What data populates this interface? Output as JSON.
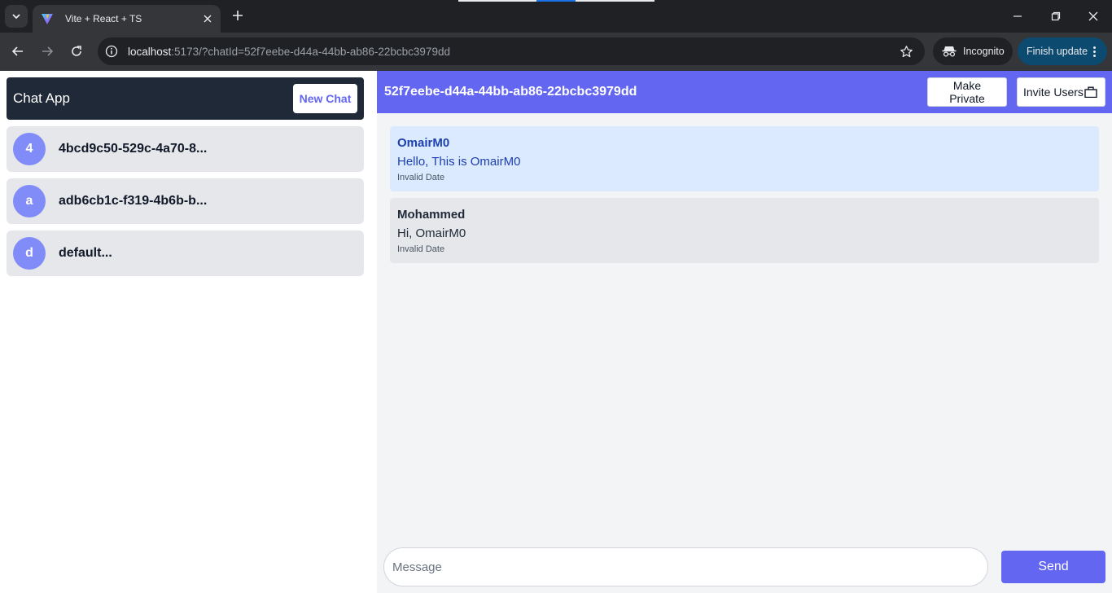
{
  "browser": {
    "tab_title": "Vite + React + TS",
    "url_host": "localhost",
    "url_rest": ":5173/?chatId=52f7eebe-d44a-44bb-ab86-22bcbc3979dd",
    "incognito_label": "Incognito",
    "update_label": "Finish update",
    "icons": [
      "tab-search-icon",
      "vite-favicon-icon",
      "close-icon",
      "plus-icon",
      "minimize-icon",
      "restore-icon",
      "close-window-icon",
      "back-arrow-icon",
      "forward-arrow-icon",
      "reload-icon",
      "site-info-icon",
      "star-icon",
      "incognito-icon",
      "kebab-menu-icon"
    ]
  },
  "sidebar": {
    "app_title": "Chat App",
    "new_chat_label": "New Chat",
    "chats": [
      {
        "initial": "4",
        "name": "4bcd9c50-529c-4a70-8..."
      },
      {
        "initial": "a",
        "name": "adb6cb1c-f319-4b6b-b..."
      },
      {
        "initial": "d",
        "name": "default..."
      }
    ]
  },
  "chat": {
    "title": "52f7eebe-d44a-44bb-ab86-22bcbc3979dd",
    "make_private_label": "Make Private",
    "invite_users_label": "Invite Users",
    "messages": [
      {
        "author": "OmairM0",
        "text": "Hello, This is OmairM0",
        "date": "Invalid Date"
      },
      {
        "author": "Mohammed",
        "text": "Hi, OmairM0",
        "date": "Invalid Date"
      }
    ],
    "input_placeholder": "Message",
    "send_label": "Send"
  },
  "colors": {
    "accent": "#6366f1",
    "avatar": "#818cf8",
    "sidebar_header": "#1f2937",
    "self_message_bg": "#dbeafe",
    "other_message_bg": "#e5e7eb"
  }
}
